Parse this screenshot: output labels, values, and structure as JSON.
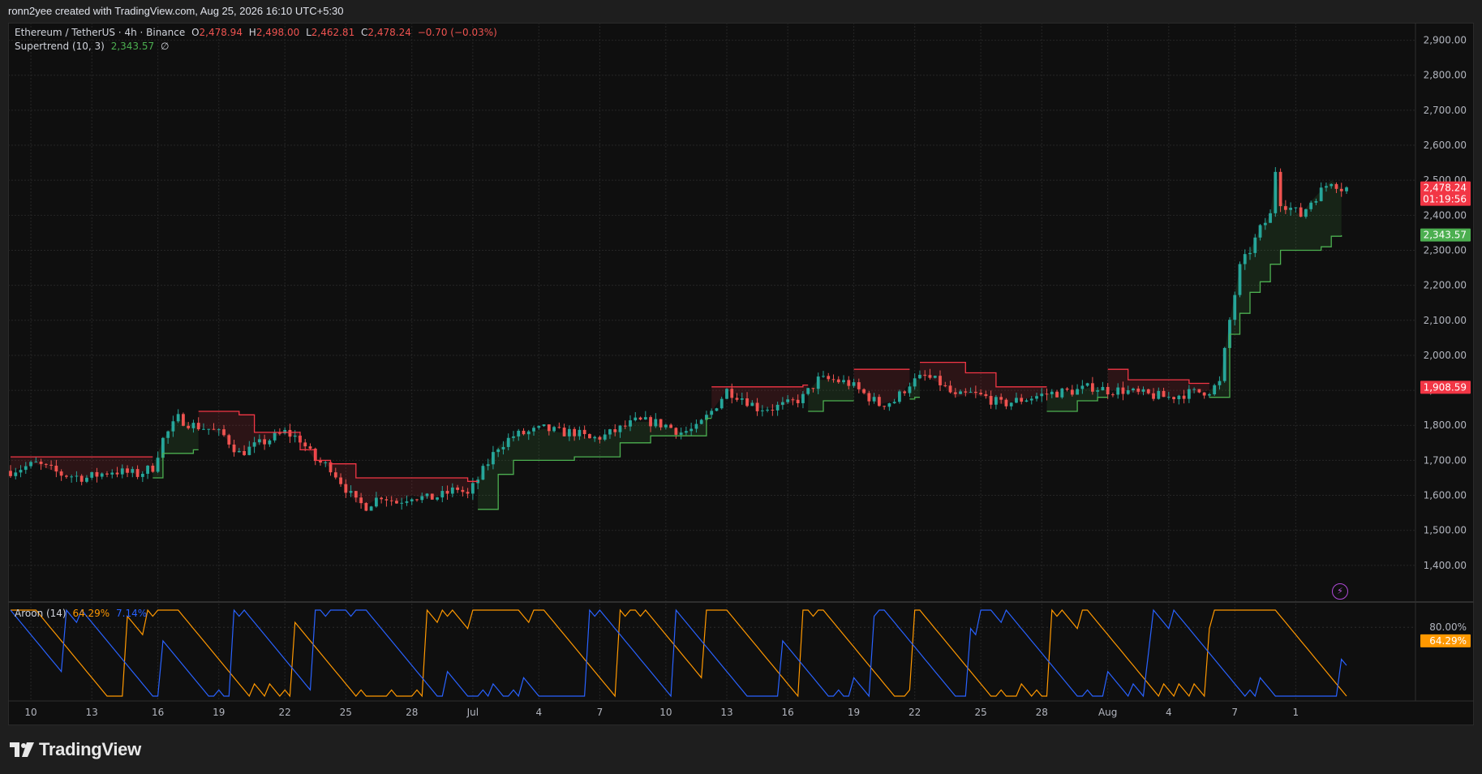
{
  "header": {
    "credit": "ronn2yee created with TradingView.com, Aug 25, 2026 16:10 UTC+5:30"
  },
  "legend": {
    "symbol": "Ethereum / TetherUS · 4h · Binance",
    "open_label": "O",
    "open": "2,478.94",
    "high_label": "H",
    "high": "2,498.00",
    "low_label": "L",
    "low": "2,462.81",
    "close_label": "C",
    "close": "2,478.24",
    "change": "−0.70 (−0.03%)",
    "supertrend_label": "Supertrend (10, 3)",
    "supertrend_value": "2,343.57",
    "supertrend_extra": "∅",
    "aroon_label": "Aroon (14)",
    "aroon_up": "64.29%",
    "aroon_down": "7.14%"
  },
  "footer": {
    "brand": "TradingView"
  },
  "colors": {
    "up": "#26a69a",
    "down": "#ef5350",
    "st_up": "#4caf50",
    "st_down": "#f23645",
    "aroon_up": "#ff9800",
    "aroon_down": "#2962ff"
  },
  "chart_data": [
    {
      "type": "line",
      "subtype": "candlestick",
      "title": "Ethereum / TetherUS · 4h · Binance",
      "x_labels": [
        "10",
        "13",
        "16",
        "19",
        "22",
        "25",
        "28",
        "Jul",
        "4",
        "7",
        "10",
        "13",
        "16",
        "19",
        "22",
        "25",
        "28",
        "Aug",
        "4",
        "7",
        "1"
      ],
      "ylim": [
        1300,
        2950
      ],
      "y_ticks": [
        "1,400.00",
        "1,500.00",
        "1,600.00",
        "1,700.00",
        "1,800.00",
        "1,900.00",
        "2,000.00",
        "2,100.00",
        "2,200.00",
        "2,300.00",
        "2,400.00",
        "2,500.00",
        "2,600.00",
        "2,700.00",
        "2,800.00",
        "2,900.00"
      ],
      "y_tick_values": [
        1400,
        1500,
        1600,
        1700,
        1800,
        1900,
        2000,
        2100,
        2200,
        2300,
        2400,
        2500,
        2600,
        2700,
        2800,
        2900
      ],
      "price_labels": [
        {
          "value": 2478.24,
          "text": "2,478.24",
          "sub": "01:19:56",
          "color": "#f23645"
        },
        {
          "value": 2343.57,
          "text": "2,343.57",
          "color": "#4caf50"
        },
        {
          "value": 1908.59,
          "text": "1,908.59",
          "color": "#f23645"
        }
      ],
      "close_path": [
        [
          0,
          1670
        ],
        [
          5,
          1690
        ],
        [
          10,
          1660
        ],
        [
          15,
          1650
        ],
        [
          20,
          1670
        ],
        [
          25,
          1660
        ],
        [
          28,
          1680
        ],
        [
          30,
          1760
        ],
        [
          33,
          1820
        ],
        [
          36,
          1800
        ],
        [
          39,
          1790
        ],
        [
          42,
          1770
        ],
        [
          45,
          1720
        ],
        [
          48,
          1740
        ],
        [
          51,
          1760
        ],
        [
          54,
          1780
        ],
        [
          57,
          1760
        ],
        [
          60,
          1700
        ],
        [
          63,
          1680
        ],
        [
          66,
          1620
        ],
        [
          68,
          1580
        ],
        [
          70,
          1570
        ],
        [
          73,
          1600
        ],
        [
          76,
          1580
        ],
        [
          79,
          1600
        ],
        [
          82,
          1590
        ],
        [
          85,
          1600
        ],
        [
          88,
          1620
        ],
        [
          90,
          1600
        ],
        [
          93,
          1670
        ],
        [
          96,
          1740
        ],
        [
          99,
          1770
        ],
        [
          102,
          1780
        ],
        [
          105,
          1790
        ],
        [
          108,
          1780
        ],
        [
          111,
          1780
        ],
        [
          114,
          1760
        ],
        [
          117,
          1770
        ],
        [
          120,
          1790
        ],
        [
          123,
          1810
        ],
        [
          126,
          1810
        ],
        [
          129,
          1800
        ],
        [
          132,
          1780
        ],
        [
          135,
          1790
        ],
        [
          138,
          1840
        ],
        [
          141,
          1900
        ],
        [
          144,
          1880
        ],
        [
          147,
          1850
        ],
        [
          150,
          1850
        ],
        [
          153,
          1860
        ],
        [
          156,
          1880
        ],
        [
          159,
          1930
        ],
        [
          162,
          1930
        ],
        [
          165,
          1920
        ],
        [
          168,
          1890
        ],
        [
          171,
          1860
        ],
        [
          174,
          1870
        ],
        [
          177,
          1920
        ],
        [
          180,
          1940
        ],
        [
          183,
          1920
        ],
        [
          186,
          1880
        ],
        [
          189,
          1890
        ],
        [
          192,
          1880
        ],
        [
          195,
          1860
        ],
        [
          198,
          1870
        ],
        [
          201,
          1880
        ],
        [
          204,
          1890
        ],
        [
          207,
          1895
        ],
        [
          210,
          1900
        ],
        [
          213,
          1910
        ],
        [
          216,
          1900
        ],
        [
          219,
          1900
        ],
        [
          222,
          1890
        ],
        [
          225,
          1885
        ],
        [
          228,
          1880
        ],
        [
          231,
          1890
        ],
        [
          234,
          1895
        ],
        [
          236,
          1900
        ],
        [
          238,
          1920
        ],
        [
          240,
          2100
        ],
        [
          242,
          2250
        ],
        [
          244,
          2300
        ],
        [
          246,
          2360
        ],
        [
          248,
          2400
        ],
        [
          249,
          2530
        ],
        [
          250,
          2440
        ],
        [
          252,
          2420
        ],
        [
          254,
          2400
        ],
        [
          256,
          2440
        ],
        [
          258,
          2470
        ],
        [
          260,
          2500
        ],
        [
          262,
          2478
        ]
      ],
      "supertrend_segments": [
        {
          "dir": "down",
          "pts": [
            [
              0,
              1710
            ],
            [
              25,
              1710
            ],
            [
              28,
              1710
            ]
          ]
        },
        {
          "dir": "up",
          "pts": [
            [
              28,
              1650
            ],
            [
              30,
              1720
            ],
            [
              36,
              1730
            ],
            [
              37,
              1730
            ]
          ]
        },
        {
          "dir": "down",
          "pts": [
            [
              37,
              1840
            ],
            [
              45,
              1830
            ],
            [
              48,
              1780
            ],
            [
              54,
              1780
            ],
            [
              57,
              1730
            ],
            [
              60,
              1700
            ],
            [
              63,
              1690
            ],
            [
              68,
              1650
            ],
            [
              82,
              1650
            ],
            [
              90,
              1640
            ],
            [
              92,
              1640
            ]
          ]
        },
        {
          "dir": "up",
          "pts": [
            [
              92,
              1560
            ],
            [
              96,
              1660
            ],
            [
              99,
              1700
            ],
            [
              111,
              1710
            ],
            [
              120,
              1750
            ],
            [
              123,
              1750
            ],
            [
              126,
              1770
            ],
            [
              135,
              1770
            ],
            [
              137,
              1820
            ],
            [
              138,
              1820
            ]
          ]
        },
        {
          "dir": "down",
          "pts": [
            [
              138,
              1910
            ],
            [
              153,
              1910
            ],
            [
              156,
              1915
            ],
            [
              157,
              1915
            ]
          ]
        },
        {
          "dir": "up",
          "pts": [
            [
              157,
              1840
            ],
            [
              160,
              1870
            ],
            [
              165,
              1870
            ],
            [
              166,
              1870
            ]
          ]
        },
        {
          "dir": "down",
          "pts": [
            [
              166,
              1960
            ],
            [
              175,
              1960
            ],
            [
              177,
              1960
            ]
          ]
        },
        {
          "dir": "up",
          "pts": [
            [
              177,
              1875
            ],
            [
              178,
              1880
            ],
            [
              179,
              1880
            ]
          ]
        },
        {
          "dir": "down",
          "pts": [
            [
              179,
              1980
            ],
            [
              185,
              1980
            ],
            [
              188,
              1950
            ],
            [
              192,
              1950
            ],
            [
              194,
              1910
            ],
            [
              204,
              1910
            ]
          ]
        },
        {
          "dir": "up",
          "pts": [
            [
              204,
              1840
            ],
            [
              210,
              1870
            ],
            [
              214,
              1880
            ],
            [
              216,
              1880
            ]
          ]
        },
        {
          "dir": "down",
          "pts": [
            [
              216,
              1960
            ],
            [
              220,
              1930
            ],
            [
              232,
              1920
            ],
            [
              236,
              1920
            ]
          ]
        },
        {
          "dir": "up",
          "pts": [
            [
              236,
              1880
            ],
            [
              238,
              1880
            ],
            [
              240,
              2060
            ],
            [
              242,
              2120
            ],
            [
              244,
              2180
            ],
            [
              246,
              2210
            ],
            [
              248,
              2260
            ],
            [
              250,
              2300
            ],
            [
              258,
              2310
            ],
            [
              260,
              2340
            ],
            [
              262,
              2343
            ]
          ]
        }
      ]
    },
    {
      "type": "line",
      "title": "Aroon (14)",
      "ylim": [
        0,
        100
      ],
      "y_ticks": [
        "80.00%"
      ],
      "y_tick_values": [
        80
      ],
      "price_labels": [
        {
          "value": 64.29,
          "text": "64.29%",
          "color": "#ff9800"
        }
      ],
      "series": [
        {
          "name": "Aroon Up",
          "last": 64.29
        },
        {
          "name": "Aroon Down",
          "last": 7.14
        }
      ]
    }
  ]
}
